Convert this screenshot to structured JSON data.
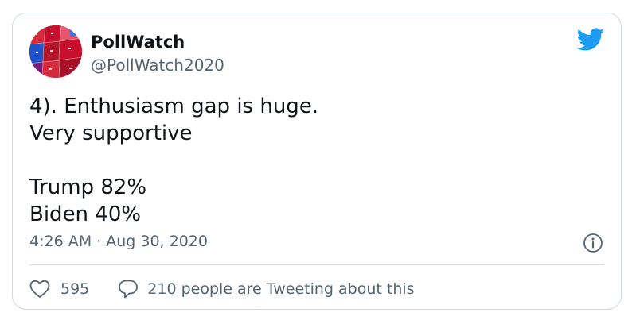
{
  "tweet": {
    "author": {
      "display_name": "PollWatch",
      "handle": "@PollWatch2020",
      "avatar_icon": "electoral-map-avatar"
    },
    "text_lines": [
      "4). Enthusiasm gap is huge.",
      "Very supportive",
      "",
      "Trump 82%",
      "Biden 40%"
    ],
    "timestamp": "4:26 AM · Aug 30, 2020",
    "likes": "595",
    "tweeting_about": "210 people are Tweeting about this"
  },
  "icons": {
    "brand": "twitter-bird-icon",
    "info": "info-icon",
    "like": "heart-icon",
    "reply": "speech-bubble-icon"
  },
  "colors": {
    "brand_blue": "#1d9bf0",
    "text_primary": "#0f1419",
    "text_secondary": "#536471",
    "border": "#cfd9de",
    "map_red": "#c8102e",
    "map_blue": "#1f4fc9"
  }
}
